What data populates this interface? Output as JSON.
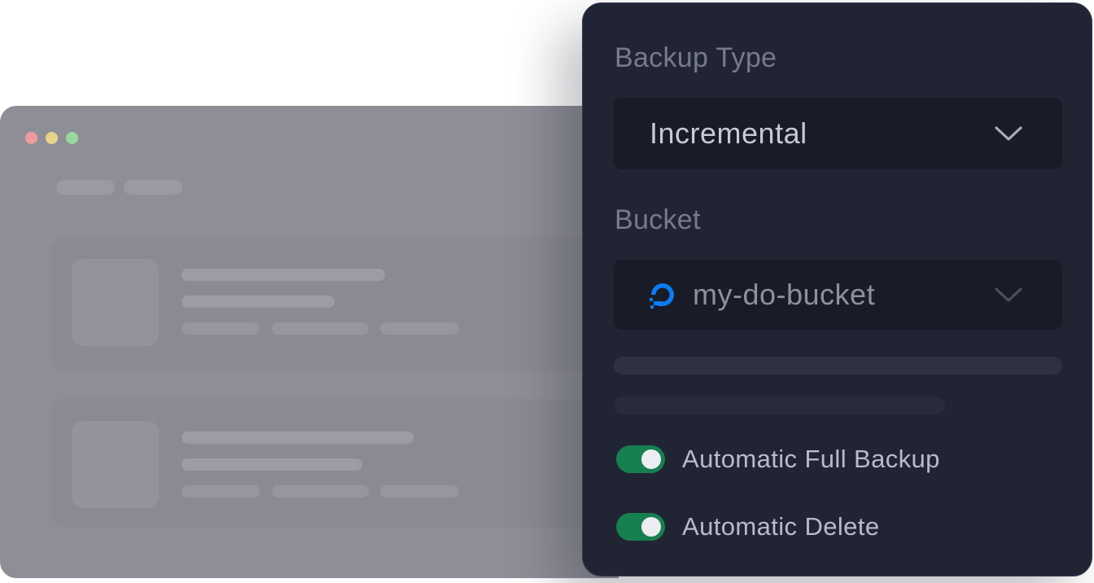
{
  "panel": {
    "backup_type": {
      "label": "Backup Type",
      "selected": "Incremental"
    },
    "bucket": {
      "label": "Bucket",
      "selected": "my-do-bucket",
      "provider_icon": "digitalocean-icon"
    },
    "toggles": [
      {
        "label": "Automatic Full Backup",
        "on": true
      },
      {
        "label": "Automatic Delete",
        "on": true
      }
    ]
  },
  "colors": {
    "panel_bg": "#212433",
    "select_bg": "#191b26",
    "toggle_on": "#178051",
    "digitalocean_blue": "#0b7cf1",
    "window_bg": "#8e8e97"
  }
}
